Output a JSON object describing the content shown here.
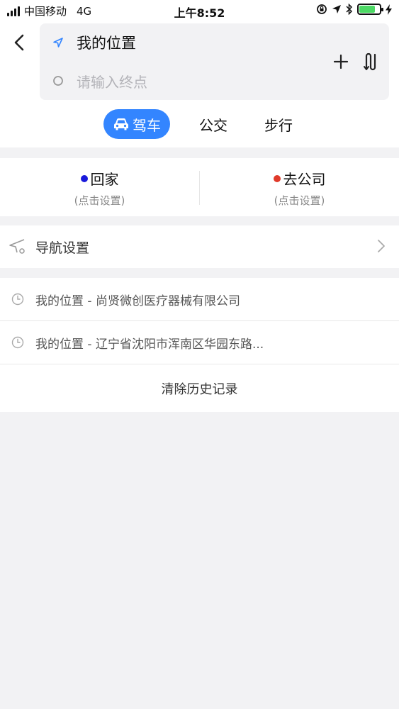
{
  "status_bar": {
    "carrier": "中国移动",
    "network": "4G",
    "time": "上午8:52"
  },
  "route": {
    "from_text": "我的位置",
    "to_placeholder": "请输入终点"
  },
  "modes": {
    "drive": "驾车",
    "bus": "公交",
    "walk": "步行"
  },
  "quick": {
    "home": {
      "label": "回家",
      "hint": "(点击设置)",
      "color": "#1a1adb"
    },
    "work": {
      "label": "去公司",
      "hint": "(点击设置)",
      "color": "#e03a2a"
    }
  },
  "nav_settings": {
    "label": "导航设置"
  },
  "history": {
    "items": [
      {
        "text": "我的位置 - 尚贤微创医疗器械有限公司"
      },
      {
        "text": "我的位置 - 辽宁省沈阳市浑南区华园东路..."
      }
    ],
    "clear_label": "清除历史记录"
  },
  "colors": {
    "accent": "#3385ff",
    "battery": "#4cd964"
  }
}
